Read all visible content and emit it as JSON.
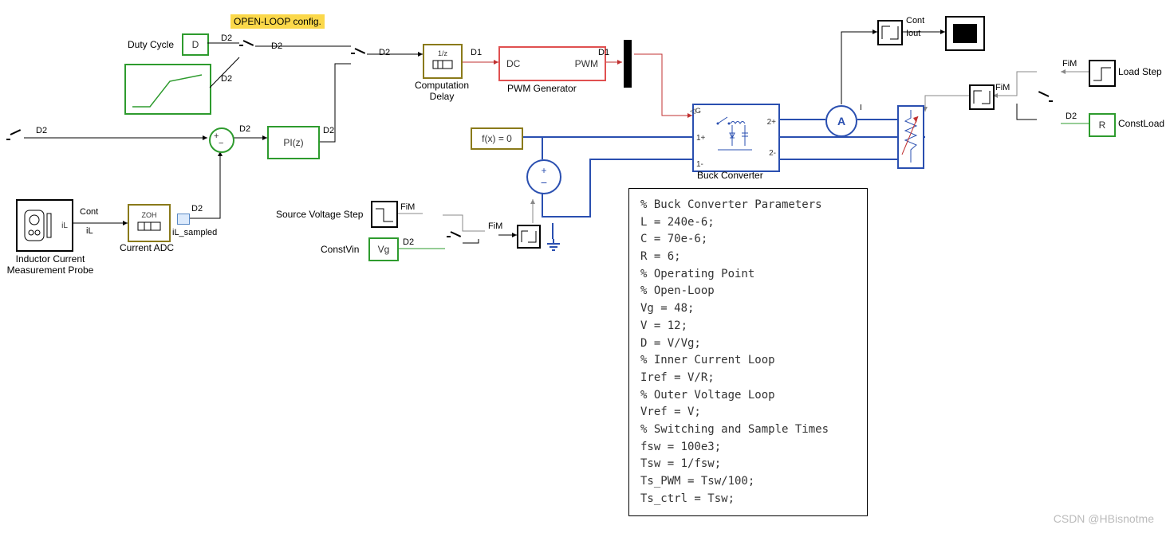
{
  "header": {
    "config_label": "OPEN-LOOP config."
  },
  "labels": {
    "duty_cycle": "Duty Cycle",
    "comp_delay": "Computation\nDelay",
    "pwm_gen": "PWM Generator",
    "buck": "Buck Converter",
    "curr_adc": "Current ADC",
    "probe": "Inductor Current\nMeasurement Probe",
    "src_step": "Source Voltage Step",
    "constvin": "ConstVin",
    "load_step": "Load Step",
    "constload": "ConstLoad"
  },
  "block_text": {
    "D": "D",
    "PI": "PI(z)",
    "fx0": "f(x) = 0",
    "Vg": "Vg",
    "R": "R",
    "ZOH": "ZOH",
    "oneOverZ": "1/z",
    "DC": "DC",
    "PWM": "PWM",
    "G": "G",
    "oneP": "1+",
    "oneM": "1-",
    "twoP": "2+",
    "twoM": "2-",
    "A": "A",
    "I": "I",
    "iL": "iL"
  },
  "signals": {
    "D2": "D2",
    "D1": "D1",
    "FiM": "FiM",
    "Cont": "Cont",
    "iL": "iL",
    "iL_sampled": "iL_sampled",
    "Iout": "Iout"
  },
  "params_text": "% Buck Converter Parameters\nL = 240e-6;\nC = 70e-6;\nR = 6;\n% Operating Point\n% Open-Loop\nVg = 48;\nV = 12;\nD = V/Vg;\n% Inner Current Loop\nIref = V/R;\n% Outer Voltage Loop\nVref = V;\n% Switching and Sample Times\nfsw = 100e3;\nTsw = 1/fsw;\nTs_PWM = Tsw/100;\nTs_ctrl = Tsw;",
  "watermark": "CSDN @HBisnotme"
}
